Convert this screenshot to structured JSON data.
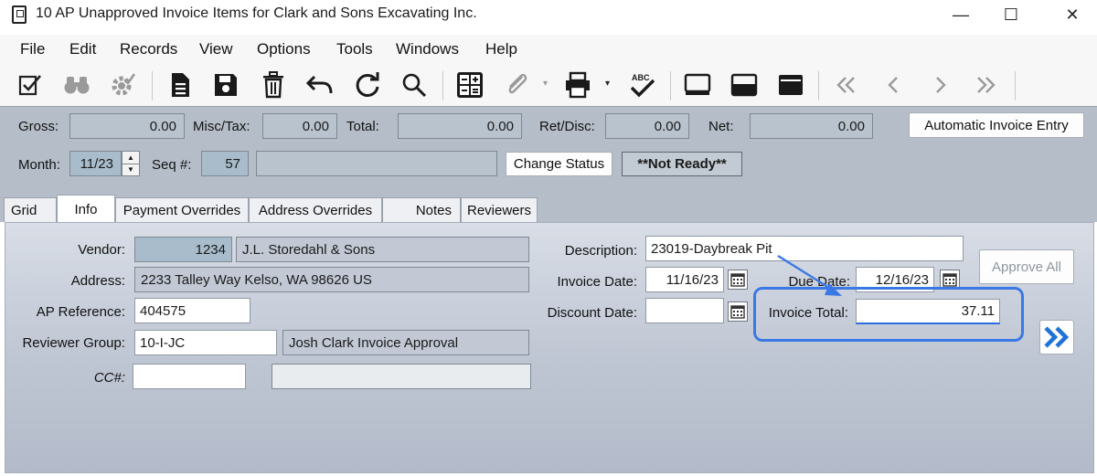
{
  "window": {
    "title": "10 AP Unapproved Invoice Items for Clark and Sons Excavating Inc.",
    "controls": {
      "minimize": "—",
      "maximize": "☐",
      "close": "✕"
    }
  },
  "menu": [
    "File",
    "Edit",
    "Records",
    "View",
    "Options",
    "Tools",
    "Windows",
    "Help"
  ],
  "toolbar": {
    "icons": [
      "checklist-icon",
      "binoculars-icon",
      "settings-check-icon",
      "document-icon",
      "save-icon",
      "delete-icon",
      "undo-icon",
      "refresh-icon",
      "search-icon",
      "grid-calc-icon",
      "attachment-icon",
      "print-icon",
      "spellcheck-icon",
      "layout-single-icon",
      "layout-split-icon",
      "layout-header-icon",
      "first-record-icon",
      "previous-record-icon",
      "next-record-icon",
      "last-record-icon"
    ],
    "spellcheck_text": "ABC"
  },
  "header": {
    "gross_label": "Gross:",
    "gross_value": "0.00",
    "misc_label": "Misc/Tax:",
    "misc_value": "0.00",
    "total_label": "Total:",
    "total_value": "0.00",
    "retdisc_label": "Ret/Disc:",
    "retdisc_value": "0.00",
    "net_label": "Net:",
    "net_value": "0.00",
    "auto_entry_button": "Automatic Invoice Entry",
    "month_label": "Month:",
    "month_value": "11/23",
    "seq_label": "Seq #:",
    "seq_value": "57",
    "seq_desc_value": "",
    "change_status_button": "Change Status",
    "status_badge": "**Not Ready**"
  },
  "tabs": [
    "Grid",
    "Info",
    "Payment Overrides",
    "Address Overrides",
    "Notes",
    "Reviewers"
  ],
  "active_tab": "Info",
  "info": {
    "vendor_label": "Vendor:",
    "vendor_id": "1234",
    "vendor_name": "J.L. Storedahl & Sons",
    "address_label": "Address:",
    "address_value": "2233 Talley Way  Kelso, WA  98626  US",
    "apref_label": "AP Reference:",
    "apref_value": "404575",
    "reviewer_label": "Reviewer Group:",
    "reviewer_code": "10-I-JC",
    "reviewer_name": "Josh Clark Invoice Approval",
    "cc_label": "CC#:",
    "cc_value": "",
    "cc_desc_value": "",
    "description_label": "Description:",
    "description_value": "23019-Daybreak Pit",
    "invoice_date_label": "Invoice Date:",
    "invoice_date_value": "11/16/23",
    "due_date_label": "Due Date:",
    "due_date_value": "12/16/23",
    "discount_date_label": "Discount Date:",
    "discount_date_value": "",
    "invoice_total_label": "Invoice Total:",
    "invoice_total_value": "37.11",
    "approve_all_button": "Approve All"
  },
  "colors": {
    "header_panel": "#b5bec8",
    "highlight_annotation": "#3a78e6",
    "accent_arrow_button": "#1f73d8"
  }
}
